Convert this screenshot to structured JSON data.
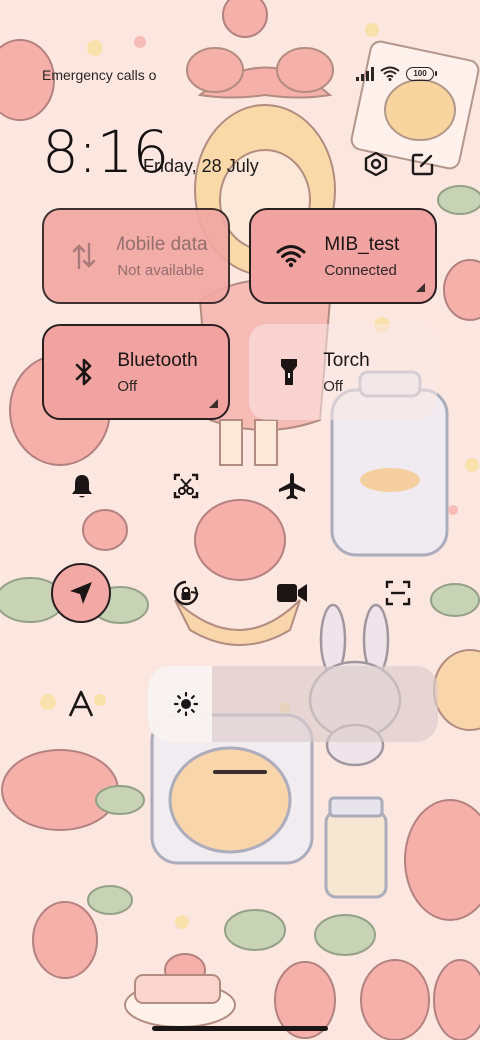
{
  "status_bar": {
    "carrier_text": "Emergency calls o",
    "battery": "100",
    "signal_icon": "signal-icon",
    "wifi_icon": "wifi-icon"
  },
  "header": {
    "time": "8:16",
    "date": "Friday, 28 July"
  },
  "tiles": {
    "mobile_data": {
      "title": "Mobile data",
      "status": "Not available"
    },
    "wifi": {
      "title": "MIB_test",
      "status": "Connected"
    },
    "bluetooth": {
      "title": "Bluetooth",
      "status": "Off"
    },
    "torch": {
      "title": "Torch",
      "status": "Off"
    }
  },
  "toggles": [
    "bell",
    "screenshot",
    "airplane",
    "location",
    "rotation-lock",
    "video",
    "scan",
    "font-size"
  ],
  "brightness": {
    "level": 0.22
  },
  "colors": {
    "active_tile": "#f0a3a0",
    "outline": "#2a1f1f"
  }
}
